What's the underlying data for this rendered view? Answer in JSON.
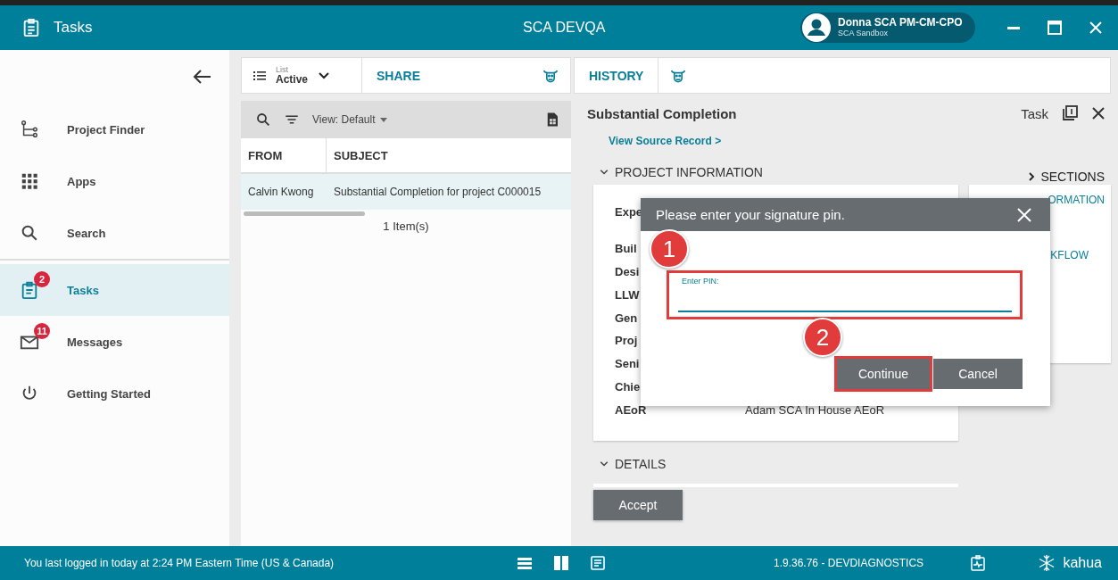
{
  "window": {
    "app_title": "Tasks",
    "center_title": "SCA DEVQA",
    "user": {
      "name": "Donna SCA PM-CM-CPO",
      "org": "SCA Sandbox"
    }
  },
  "sidebar": {
    "groups": [
      {
        "items": [
          {
            "kind": "tree",
            "label": "Project Finder",
            "selected": false
          },
          {
            "kind": "apps",
            "label": "Apps",
            "selected": false
          },
          {
            "kind": "search",
            "label": "Search",
            "selected": false
          }
        ]
      },
      {
        "items": [
          {
            "kind": "tasks",
            "label": "Tasks",
            "badge": "2",
            "selected": true
          },
          {
            "kind": "mail",
            "label": "Messages",
            "badge": "11",
            "selected": false
          },
          {
            "kind": "power",
            "label": "Getting Started",
            "selected": false
          }
        ]
      }
    ]
  },
  "toolbar": {
    "list_caption": "List",
    "list_value": "Active",
    "share": "SHARE",
    "history": "HISTORY"
  },
  "list_panel": {
    "view": "View: Default",
    "columns": [
      "FROM",
      "SUBJECT"
    ],
    "rows": [
      {
        "from": "Calvin Kwong",
        "subject": "Substantial Completion for project C000015",
        "selected": true
      }
    ],
    "count": "1 Item(s)"
  },
  "detail": {
    "title": "Substantial Completion",
    "type": "Task",
    "link": "View Source Record >",
    "sections": [
      {
        "title": "PROJECT INFORMATION",
        "expanded": true
      },
      {
        "title": "DETAILS",
        "expanded": true
      }
    ],
    "fields": [
      {
        "label": "Expe"
      },
      {
        "label": "Buil"
      },
      {
        "label": "Desi"
      },
      {
        "label": "LLW"
      },
      {
        "label": "Gen"
      },
      {
        "label": "Proj"
      },
      {
        "label": "Seni"
      },
      {
        "label": "Chie"
      },
      {
        "label": "AEoR",
        "value": "Adam SCA In House AEoR"
      }
    ],
    "nav": {
      "title": "SECTIONS",
      "items": [
        "ORMATION",
        "KFLOW"
      ]
    },
    "accept": "Accept"
  },
  "dialog": {
    "title": "Please enter your signature pin.",
    "field_label": "Enter PIN:",
    "buttons": [
      "Continue",
      "Cancel"
    ],
    "annotations": [
      {
        "number": "1"
      },
      {
        "number": "2"
      }
    ]
  },
  "status_bar": {
    "message": "You last logged in today at 2:24 PM Eastern Time (US & Canada)",
    "version": "1.9.36.76 - DEVDIAGNOSTICS",
    "brand": "kahua"
  }
}
